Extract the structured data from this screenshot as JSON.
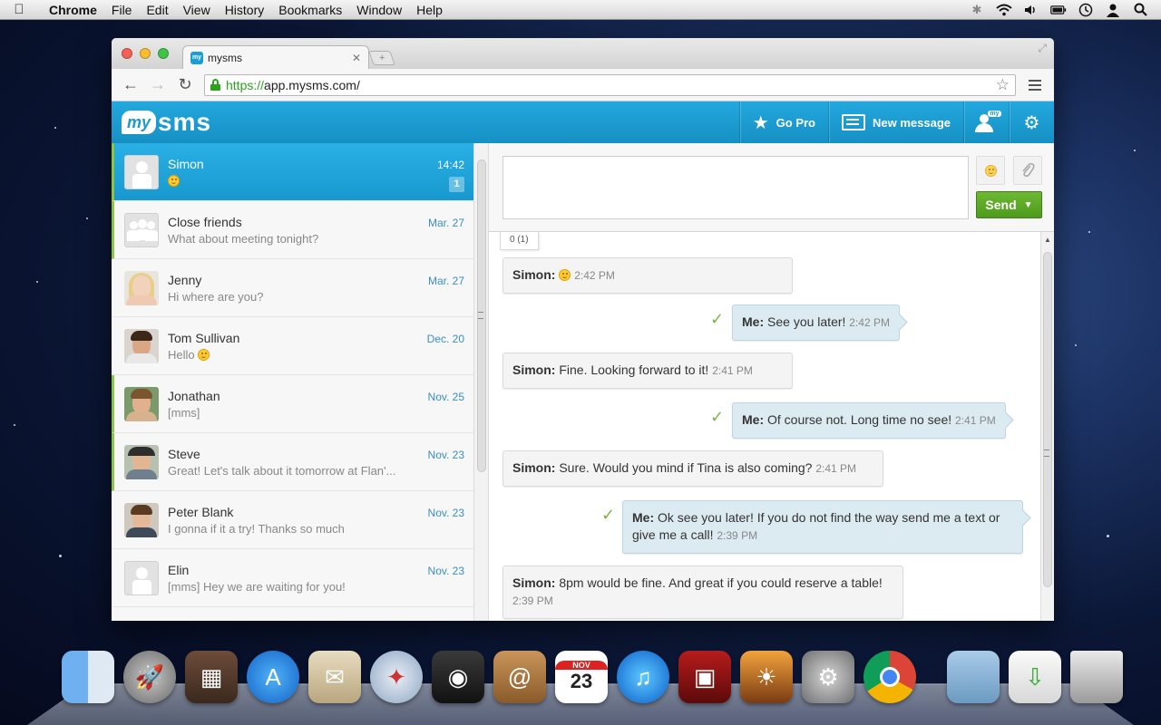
{
  "menubar": {
    "app_name": "Chrome",
    "items": [
      "File",
      "Edit",
      "View",
      "History",
      "Bookmarks",
      "Window",
      "Help"
    ]
  },
  "browser": {
    "tab_title": "mysms",
    "tab_favicon_text": "my",
    "url_scheme": "https://",
    "url_rest": "app.mysms.com/"
  },
  "header": {
    "logo_my": "my",
    "logo_sms": "sms",
    "go_pro": "Go Pro",
    "new_message": "New message",
    "people_tag": "my"
  },
  "conversations": [
    {
      "name": "Simon",
      "date": "14:42",
      "preview": "",
      "preview_emoji": true,
      "badge": "1",
      "active": true,
      "unread": true,
      "avatar": "placeholder"
    },
    {
      "name": "Close friends",
      "date": "Mar. 27",
      "preview": "What about meeting tonight?",
      "active": false,
      "unread": true,
      "avatar": "group"
    },
    {
      "name": "Jenny",
      "date": "Mar. 27",
      "preview": "Hi where are you?",
      "active": false,
      "unread": false,
      "avatar": "photo"
    },
    {
      "name": "Tom Sullivan",
      "date": "Dec. 20",
      "preview": "Hello",
      "preview_emoji": true,
      "active": false,
      "unread": false,
      "avatar": "photo"
    },
    {
      "name": "Jonathan",
      "date": "Nov. 25",
      "preview": "[mms]",
      "active": false,
      "unread": true,
      "avatar": "photo"
    },
    {
      "name": "Steve",
      "date": "Nov. 23",
      "preview": "Great! Let's talk about it tomorrow at Flan'...",
      "active": false,
      "unread": true,
      "avatar": "photo"
    },
    {
      "name": "Peter Blank",
      "date": "Nov. 23",
      "preview": "I gonna if it a try! Thanks so much",
      "active": false,
      "unread": false,
      "avatar": "photo"
    },
    {
      "name": "Elin",
      "date": "Nov. 23",
      "preview": "[mms] Hey we are waiting for you!",
      "active": false,
      "unread": false,
      "avatar": "placeholder"
    }
  ],
  "composer": {
    "placeholder": "",
    "send_label": "Send",
    "char_count": "0 (1)"
  },
  "messages": [
    {
      "dir": "in",
      "who": "Simon:",
      "text": "",
      "emoji": true,
      "time": "2:42 PM"
    },
    {
      "dir": "out",
      "who": "Me:",
      "text": "See you later!",
      "time": "2:42 PM"
    },
    {
      "dir": "in",
      "who": "Simon:",
      "text": "Fine. Looking forward to it!",
      "time": "2:41 PM"
    },
    {
      "dir": "out",
      "who": "Me:",
      "text": "Of course not. Long time no see!",
      "time": "2:41 PM"
    },
    {
      "dir": "in",
      "who": "Simon:",
      "text": "Sure. Would you mind if Tina is also coming?",
      "time": "2:41 PM"
    },
    {
      "dir": "out",
      "who": "Me:",
      "text": "Ok see you later! If you do not find the way send me a text or give me a call!",
      "time": "2:39 PM"
    },
    {
      "dir": "in",
      "who": "Simon:",
      "text": "8pm would be fine. And great if you could reserve a table!",
      "time": "2:39 PM"
    }
  ],
  "dock": {
    "calendar_month": "NOV",
    "calendar_day": "23"
  },
  "colors": {
    "brand_blue": "#1b9ad2",
    "send_green": "#5aa626",
    "unread_accent": "#8cc63f"
  }
}
